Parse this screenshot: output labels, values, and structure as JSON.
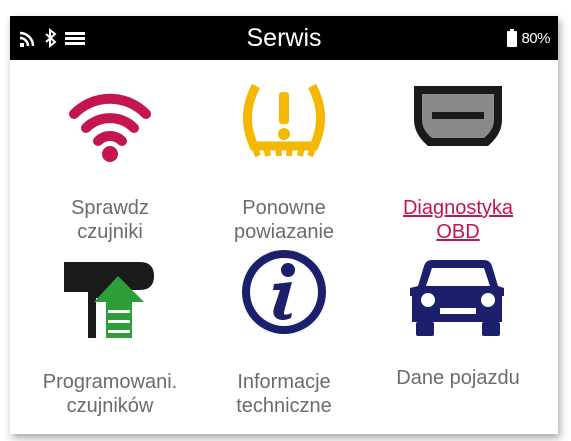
{
  "statusbar": {
    "title": "Serwis",
    "battery_percent": "80%",
    "icons": [
      "signal-icon",
      "bluetooth-icon",
      "menu-icon",
      "battery-icon"
    ]
  },
  "menu": {
    "items": [
      {
        "label": "Sprawdz\nczujniki",
        "icon": "wifi-sensor-icon",
        "color": "#c4154f"
      },
      {
        "label": "Ponowne\npowiazanie",
        "icon": "tire-pressure-warning-icon",
        "color": "#f5b800"
      },
      {
        "label": "Diagnostyka\nOBD",
        "icon": "obd-connector-icon",
        "color": "#c4154f"
      },
      {
        "label": "Programowani.\nczujników",
        "icon": "sensor-program-icon",
        "color": "#2e9e3a"
      },
      {
        "label": "Informacje\ntechniczne",
        "icon": "info-icon",
        "color": "#1c1f6b"
      },
      {
        "label": "Dane pojazdu",
        "icon": "car-icon",
        "color": "#1c1f6b"
      }
    ]
  },
  "colors": {
    "statusbar_bg": "#000000",
    "label_gray": "#6b6b6b",
    "accent_red": "#c4154f",
    "warning_yellow": "#f5b800",
    "navy": "#1c1f6b",
    "green": "#2e9e3a"
  }
}
